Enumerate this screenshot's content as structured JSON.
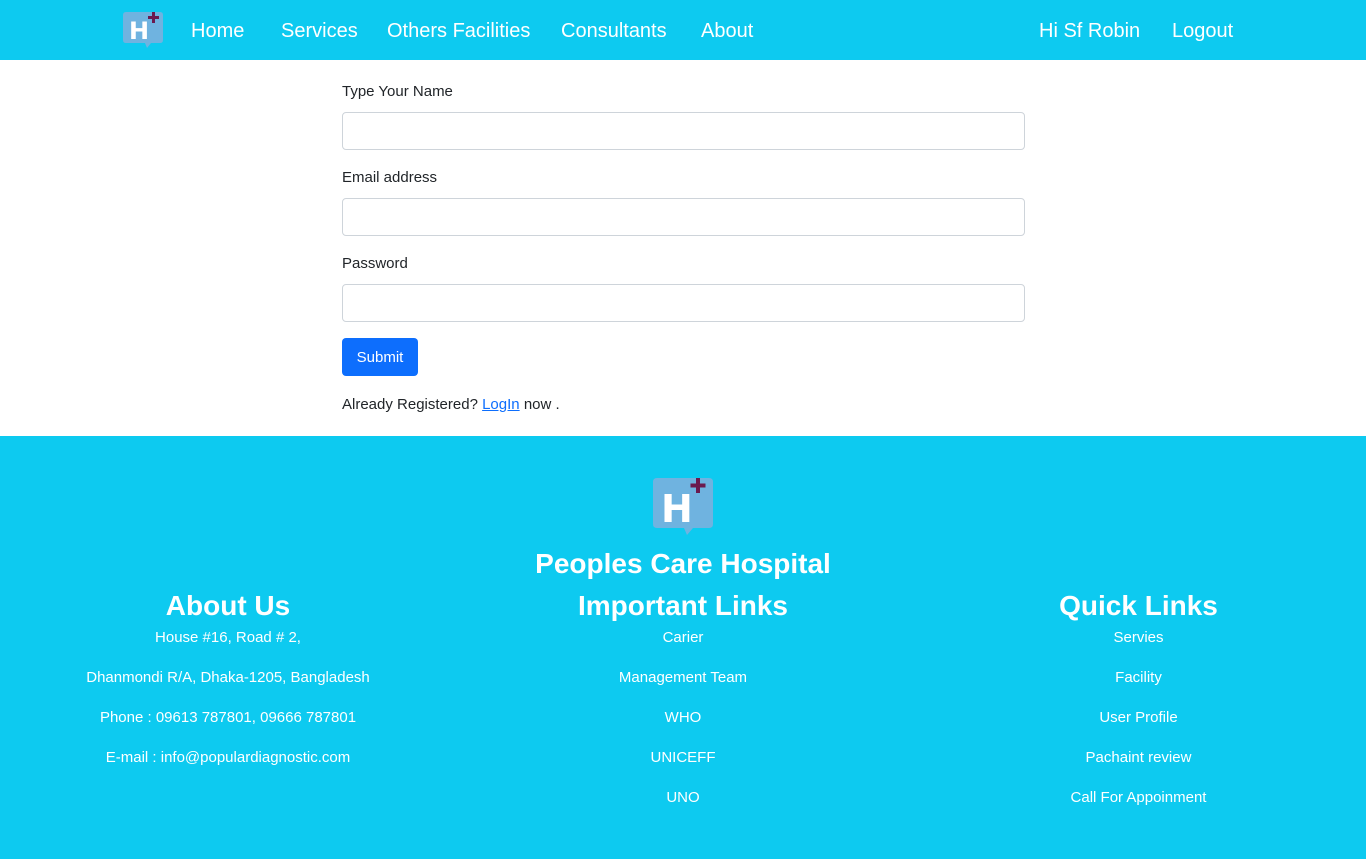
{
  "navbar": {
    "logo_icon": "hospital-h-plus-icon",
    "links": [
      "Home",
      "Services",
      "Others Facilities",
      "Consultants",
      "About"
    ],
    "greeting": "Hi Sf Robin",
    "logout": "Logout"
  },
  "form": {
    "name_label": "Type Your Name",
    "name_value": "",
    "email_label": "Email address",
    "email_value": "",
    "password_label": "Password",
    "password_value": "",
    "submit_label": "Submit",
    "already_prefix": "Already Registered?",
    "login_link": "LogIn",
    "already_suffix": "now ."
  },
  "footer": {
    "logo_icon": "hospital-h-plus-icon",
    "title": "Peoples Care Hospital",
    "about": {
      "heading": "About Us",
      "lines": [
        "House #16, Road # 2,",
        "Dhanmondi R/A, Dhaka-1205, Bangladesh",
        "Phone : 09613 787801, 09666 787801",
        "E-mail : info@populardiagnostic.com"
      ]
    },
    "important": {
      "heading": "Important Links",
      "links": [
        "Carier",
        "Management Team",
        "WHO",
        "UNICEFF",
        "UNO"
      ]
    },
    "quick": {
      "heading": "Quick Links",
      "links": [
        "Servies",
        "Facility",
        "User Profile",
        "Pachaint review",
        "Call For Appoinment"
      ]
    }
  },
  "colors": {
    "brand": "#0dcaf0",
    "button": "#0d6efd",
    "logo_tile": "#6fb3e0",
    "logo_plus": "#6b1a4f"
  }
}
